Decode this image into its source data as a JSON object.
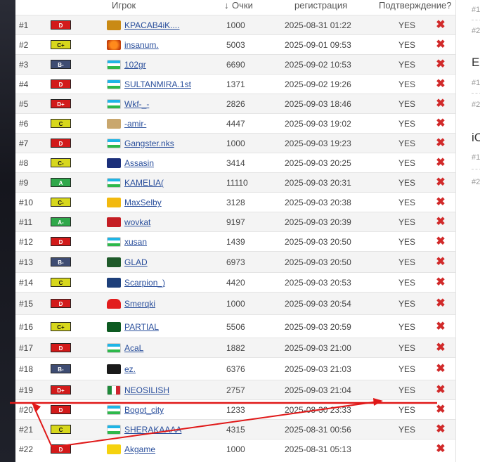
{
  "header": {
    "player": "Игрок",
    "points": "Очки",
    "sort_arrow": "↓",
    "registration": "регистрация",
    "confirmation": "Подтверждение?"
  },
  "sidebar_right": {
    "items": [
      "#1",
      "#2",
      "E",
      "#1",
      "#2",
      "iC",
      "#1",
      "#2"
    ]
  },
  "rating_colors": {
    "D": "#d21a1a",
    "D+": "#d21a1a",
    "C": "#d7d71c",
    "C+": "#d7d71c",
    "C-": "#d7d71c",
    "B-": "#3e4c72",
    "A": "#2fa84a",
    "A-": "#2fa84a"
  },
  "rows": [
    {
      "rank": "#1",
      "rating": "D",
      "avatar": "king-logo",
      "name": "KPACAB4iK....",
      "points": "1000",
      "registered": "2025-08-31 01:22",
      "confirmed": "YES"
    },
    {
      "rank": "#2",
      "rating": "C+",
      "avatar": "orange-emblem",
      "name": "insanum.",
      "points": "5003",
      "registered": "2025-09-01 09:53",
      "confirmed": "YES"
    },
    {
      "rank": "#3",
      "rating": "B-",
      "avatar": "uzbekistan-flag",
      "name": "102gr",
      "points": "6690",
      "registered": "2025-09-02 10:53",
      "confirmed": "YES"
    },
    {
      "rank": "#4",
      "rating": "D",
      "avatar": "uzbekistan-flag",
      "name": "SULTANMIRA.1st",
      "points": "1371",
      "registered": "2025-09-02 19:26",
      "confirmed": "YES"
    },
    {
      "rank": "#5",
      "rating": "D+",
      "avatar": "uzbekistan-flag",
      "name": "Wkf-_-",
      "points": "2826",
      "registered": "2025-09-03 18:46",
      "confirmed": "YES"
    },
    {
      "rank": "#6",
      "rating": "C",
      "avatar": "face-avatar",
      "name": "-amir-",
      "points": "4447",
      "registered": "2025-09-03 19:02",
      "confirmed": "YES"
    },
    {
      "rank": "#7",
      "rating": "D",
      "avatar": "uzbekistan-flag",
      "name": "Gangster.nks",
      "points": "1000",
      "registered": "2025-09-03 19:23",
      "confirmed": "YES"
    },
    {
      "rank": "#8",
      "rating": "C-",
      "avatar": "stars-flag",
      "name": "Assasin",
      "points": "3414",
      "registered": "2025-09-03 20:25",
      "confirmed": "YES"
    },
    {
      "rank": "#9",
      "rating": "A",
      "avatar": "uzbekistan-flag",
      "name": "KAMELIA(",
      "points": "11110",
      "registered": "2025-09-03 20:31",
      "confirmed": "YES"
    },
    {
      "rank": "#10",
      "rating": "C-",
      "avatar": "ggi-logo",
      "name": "MaxSelby",
      "points": "3128",
      "registered": "2025-09-03 20:38",
      "confirmed": "YES"
    },
    {
      "rank": "#11",
      "rating": "A-",
      "avatar": "eagle-logo",
      "name": "wovkat",
      "points": "9197",
      "registered": "2025-09-03 20:39",
      "confirmed": "YES"
    },
    {
      "rank": "#12",
      "rating": "D",
      "avatar": "uzbekistan-flag",
      "name": "xusan",
      "points": "1439",
      "registered": "2025-09-03 20:50",
      "confirmed": "YES"
    },
    {
      "rank": "#13",
      "rating": "B-",
      "avatar": "green-mask-avatar",
      "name": "GLAD",
      "points": "6973",
      "registered": "2025-09-03 20:50",
      "confirmed": "YES"
    },
    {
      "rank": "#14",
      "rating": "C",
      "avatar": "blue-s-logo",
      "name": "Scarpion_)",
      "points": "4420",
      "registered": "2025-09-03 20:53",
      "confirmed": "YES"
    },
    {
      "rank": "#15",
      "rating": "D",
      "avatar": "red-ghost-avatar",
      "name": "Smerqki",
      "points": "1000",
      "registered": "2025-09-03 20:54",
      "confirmed": "YES"
    },
    {
      "rank": "#16",
      "rating": "C+",
      "avatar": "dollar-avatar",
      "name": "PARTIAL",
      "points": "5506",
      "registered": "2025-09-03 20:59",
      "confirmed": "YES"
    },
    {
      "rank": "#17",
      "rating": "D",
      "avatar": "uzbekistan-flag",
      "name": "AcaL",
      "points": "1882",
      "registered": "2025-09-03 21:00",
      "confirmed": "YES"
    },
    {
      "rank": "#18",
      "rating": "B-",
      "avatar": "anime-avatar",
      "name": "ez.",
      "points": "6376",
      "registered": "2025-09-03 21:03",
      "confirmed": "YES"
    },
    {
      "rank": "#19",
      "rating": "D+",
      "avatar": "mexico-flag",
      "name": "NEOSILISH",
      "points": "2757",
      "registered": "2025-09-03 21:04",
      "confirmed": "YES"
    },
    {
      "rank": "#20",
      "rating": "D",
      "avatar": "uzbekistan-flag",
      "name": "Bogot_city",
      "points": "1233",
      "registered": "2025-08-30 23:33",
      "confirmed": "YES"
    },
    {
      "rank": "#21",
      "rating": "C",
      "avatar": "uzbekistan-flag",
      "name": "SHERAKAAAA",
      "points": "4315",
      "registered": "2025-08-31 00:56",
      "confirmed": "YES"
    },
    {
      "rank": "#22",
      "rating": "D",
      "avatar": "navi-logo",
      "name": "Akgame",
      "points": "1000",
      "registered": "2025-08-31 05:13",
      "confirmed": ""
    }
  ],
  "annotation_color": "#e01818"
}
